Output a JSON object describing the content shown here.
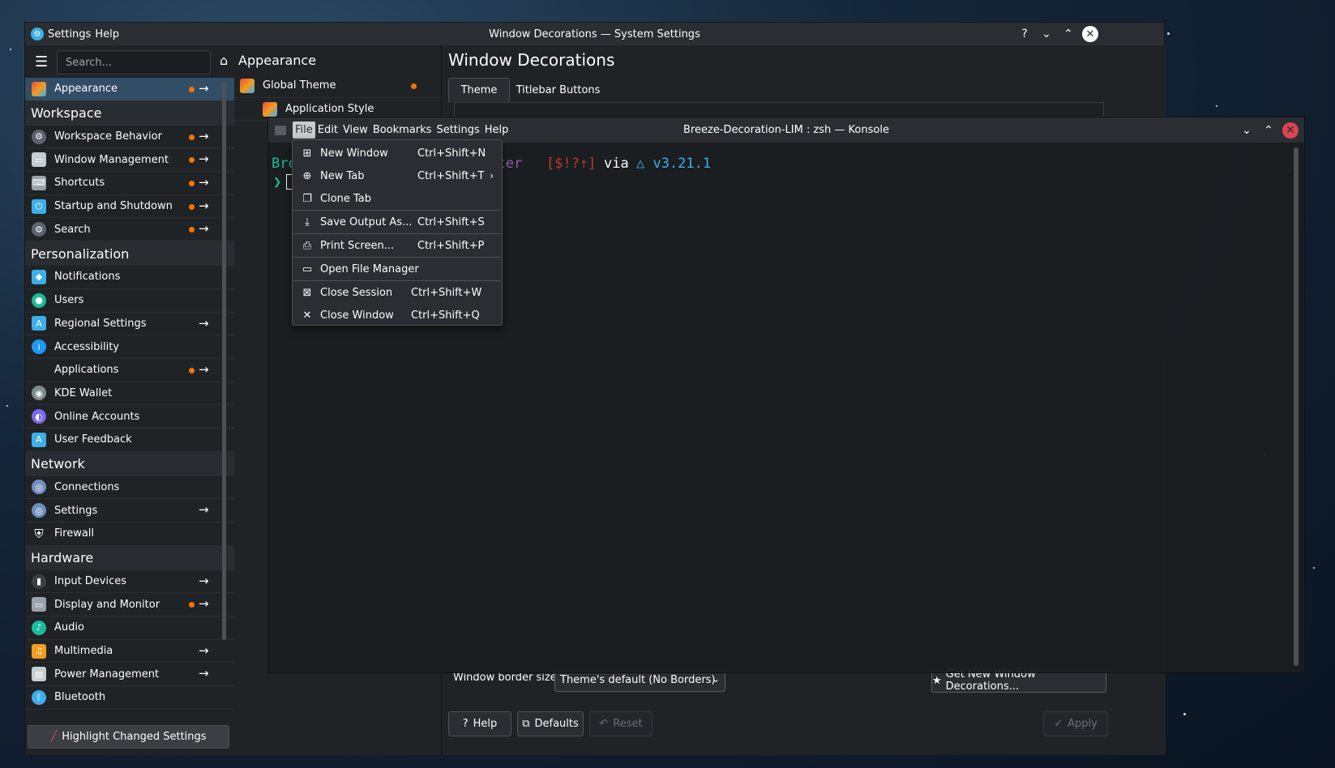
{
  "settings_window": {
    "title": "Window Decorations — System Settings",
    "menu": [
      "Settings",
      "Help"
    ],
    "search_placeholder": "Search...",
    "sidebar": {
      "top_item": {
        "label": "Appearance",
        "selected": true,
        "changed": true,
        "has_arrow": true
      },
      "categories": [
        {
          "name": "Workspace",
          "items": [
            {
              "label": "Workspace Behavior",
              "changed": true,
              "arrow": true,
              "icon": "gear-icon",
              "color": "#5d6470"
            },
            {
              "label": "Window Management",
              "changed": true,
              "arrow": true,
              "icon": "window-icon",
              "color": "#c6cdd2"
            },
            {
              "label": "Shortcuts",
              "changed": true,
              "arrow": true,
              "icon": "keyboard-icon",
              "color": "#9aa3ab"
            },
            {
              "label": "Startup and Shutdown",
              "changed": true,
              "arrow": true,
              "icon": "power-icon",
              "color": "#3daee9"
            },
            {
              "label": "Search",
              "changed": true,
              "arrow": true,
              "icon": "search-gear-icon",
              "color": "#5d6470"
            }
          ]
        },
        {
          "name": "Personalization",
          "items": [
            {
              "label": "Notifications",
              "changed": false,
              "arrow": false,
              "icon": "bell-icon",
              "color": "#3daee9"
            },
            {
              "label": "Users",
              "changed": false,
              "arrow": false,
              "icon": "user-icon",
              "color": "#1abc9c"
            },
            {
              "label": "Regional Settings",
              "changed": false,
              "arrow": true,
              "icon": "language-icon",
              "color": "#3daee9"
            },
            {
              "label": "Accessibility",
              "changed": false,
              "arrow": false,
              "icon": "accessibility-icon",
              "color": "#1d99f3"
            },
            {
              "label": "Applications",
              "changed": true,
              "arrow": true,
              "icon": "",
              "color": ""
            },
            {
              "label": "KDE Wallet",
              "changed": false,
              "arrow": false,
              "icon": "wallet-icon",
              "color": "#7f8c8d"
            },
            {
              "label": "Online Accounts",
              "changed": false,
              "arrow": false,
              "icon": "accounts-icon",
              "color": "#7b68ee"
            },
            {
              "label": "User Feedback",
              "changed": false,
              "arrow": false,
              "icon": "feedback-icon",
              "color": "#3daee9"
            }
          ]
        },
        {
          "name": "Network",
          "items": [
            {
              "label": "Connections",
              "changed": false,
              "arrow": false,
              "icon": "network-icon",
              "color": "#6f8fbf"
            },
            {
              "label": "Settings",
              "changed": false,
              "arrow": true,
              "icon": "network-settings-icon",
              "color": "#6f8fbf"
            },
            {
              "label": "Firewall",
              "changed": false,
              "arrow": false,
              "icon": "shield-icon",
              "color": "#fcfcfc"
            }
          ]
        },
        {
          "name": "Hardware",
          "items": [
            {
              "label": "Input Devices",
              "changed": false,
              "arrow": true,
              "icon": "mouse-icon",
              "color": "#3b3f44"
            },
            {
              "label": "Display and Monitor",
              "changed": true,
              "arrow": true,
              "icon": "monitor-icon",
              "color": "#9aa3ab"
            },
            {
              "label": "Audio",
              "changed": false,
              "arrow": false,
              "icon": "audio-icon",
              "color": "#1abc9c"
            },
            {
              "label": "Multimedia",
              "changed": false,
              "arrow": true,
              "icon": "multimedia-icon",
              "color": "#f39c1f"
            },
            {
              "label": "Power Management",
              "changed": false,
              "arrow": true,
              "icon": "power-management-icon",
              "color": "#c6cdd2"
            },
            {
              "label": "Bluetooth",
              "changed": false,
              "arrow": false,
              "icon": "bluetooth-icon",
              "color": "#3daee9"
            }
          ]
        }
      ],
      "highlight_button": "Highlight Changed Settings"
    },
    "middle": {
      "title": "Appearance",
      "items": [
        {
          "label": "Global Theme",
          "changed": true
        },
        {
          "label": "Application Style",
          "changed": false
        }
      ]
    },
    "content": {
      "title": "Window Decorations",
      "tabs": [
        "Theme",
        "Titlebar Buttons"
      ],
      "border_label": "Window border size:",
      "border_value": "Theme's default (No Borders)",
      "get_new": "Get New Window Decorations...",
      "buttons": {
        "help": "Help",
        "defaults": "Defaults",
        "reset": "Reset",
        "apply": "Apply"
      }
    }
  },
  "konsole": {
    "title": "Breeze-Decoration-LIM : zsh — Konsole",
    "menu": [
      "File",
      "Edit",
      "View",
      "Bookmarks",
      "Settings",
      "Help"
    ],
    "active_menu": "File",
    "terminal": {
      "dir_visible": "Bre",
      "branch": "aster",
      "status": "[$!?⇡]",
      "via": "via",
      "version": "△ v3.21.1",
      "prompt": "❯"
    },
    "file_menu": [
      {
        "label": "New Window",
        "shortcut": "Ctrl+Shift+N",
        "icon": "new-window-icon"
      },
      {
        "label": "New Tab",
        "shortcut": "Ctrl+Shift+T",
        "icon": "new-tab-icon",
        "submenu": true
      },
      {
        "label": "Clone Tab",
        "shortcut": "",
        "icon": "clone-tab-icon"
      },
      {
        "label": "Save Output As...",
        "shortcut": "Ctrl+Shift+S",
        "icon": "save-icon",
        "separator_before": true
      },
      {
        "label": "Print Screen...",
        "shortcut": "Ctrl+Shift+P",
        "icon": "print-icon",
        "separator_before": true
      },
      {
        "label": "Open File Manager",
        "shortcut": "",
        "icon": "folder-icon",
        "separator_before": true
      },
      {
        "label": "Close Session",
        "shortcut": "Ctrl+Shift+W",
        "icon": "close-session-icon",
        "separator_before": true
      },
      {
        "label": "Close Window",
        "shortcut": "Ctrl+Shift+Q",
        "icon": "close-window-icon"
      }
    ]
  }
}
